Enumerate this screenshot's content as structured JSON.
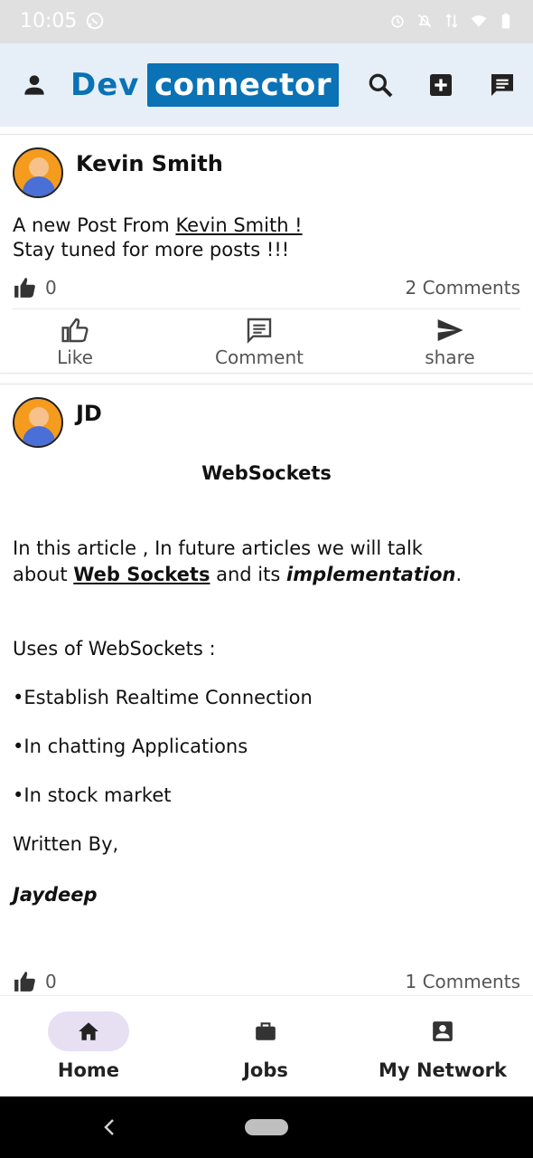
{
  "status_bar": {
    "time": "10:05",
    "left_icon": "whatsapp-icon",
    "right_icons": [
      "alarm-icon",
      "bell-off-icon",
      "data-arrows-icon",
      "wifi-icon",
      "battery-icon"
    ]
  },
  "app_bar": {
    "brand_dev": "Dev",
    "brand_connector": "connector",
    "brand_color": "#0a72b5",
    "left_icon": "person-icon",
    "right_icons": [
      "search-icon",
      "add-box-icon",
      "message-icon"
    ]
  },
  "posts": [
    {
      "author": "Kevin Smith",
      "line1_prefix": "A new Post From ",
      "line1_link": "Kevin Smith ! ",
      "line2": "Stay tuned for more posts !!!",
      "likes": "0",
      "comments": "2 Comments",
      "actions": {
        "like": "Like",
        "comment": "Comment",
        "share": "share"
      }
    },
    {
      "author": "JD",
      "title": "WebSockets",
      "p1_line1": "In this article  , In future  articles  we will talk",
      "p1_line2_prefix": "about ",
      "p1_line2_link": "Web Sockets",
      "p1_line2_mid": " and its ",
      "p1_line2_italic": "implementation",
      "p1_line2_end": ".",
      "uses_heading": "Uses of WebSockets :",
      "bullets": [
        "•Establish Realtime Connection",
        "•In chatting Applications",
        "•In stock market"
      ],
      "written_by": "Written By,",
      "signature": "Jaydeep",
      "likes": "0",
      "comments": "1 Comments"
    }
  ],
  "bottom_nav": {
    "items": [
      {
        "label": "Home",
        "icon": "home-icon",
        "active": true
      },
      {
        "label": "Jobs",
        "icon": "briefcase-icon",
        "active": false
      },
      {
        "label": "My Network",
        "icon": "contact-card-icon",
        "active": false
      }
    ],
    "active_pill_color": "#e7e0f3"
  },
  "system_nav": {
    "back_icon": "back-chevron-icon",
    "home_icon": "home-pill-icon"
  }
}
